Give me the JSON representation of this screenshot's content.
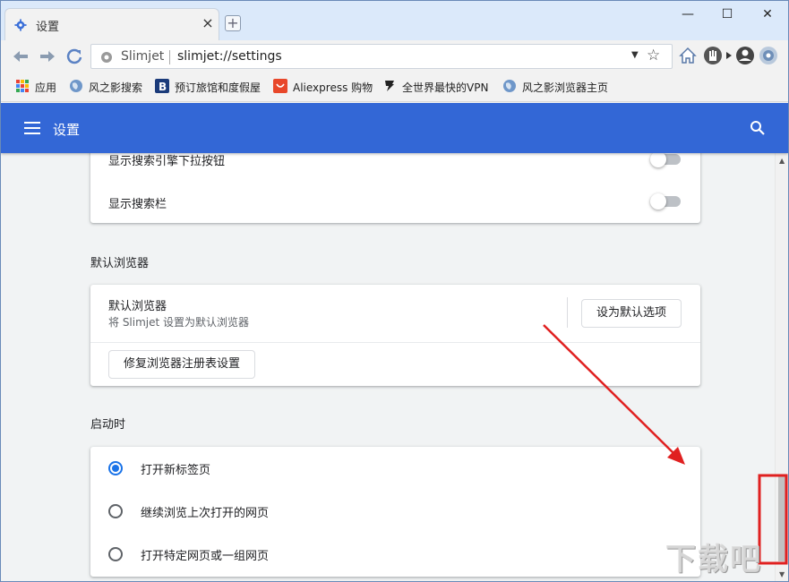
{
  "tab": {
    "title": "设置",
    "close": "×"
  },
  "newtab": "+",
  "window_controls": {
    "minimize": "—",
    "maximize": "☐",
    "close": "✕"
  },
  "omnibox": {
    "brand": "Slimjet",
    "url": "slimjet://settings",
    "dropdown": "▼",
    "star": "☆"
  },
  "bookmarks": [
    {
      "label": "应用",
      "icon": "apps-grid-icon"
    },
    {
      "label": "风之影搜索",
      "icon": "globe-icon"
    },
    {
      "label": "预订旅馆和度假屋",
      "icon": "booking-b-icon"
    },
    {
      "label": "Aliexpress 购物",
      "icon": "aliexpress-bag-icon"
    },
    {
      "label": "全世界最快的VPN",
      "icon": "vpn-icon"
    },
    {
      "label": "风之影浏览器主页",
      "icon": "globe-icon"
    }
  ],
  "header": {
    "title": "设置"
  },
  "search_section": {
    "rows": [
      {
        "label": "显示搜索引擎下拉按钮",
        "enabled": false
      },
      {
        "label": "显示搜索栏",
        "enabled": false
      }
    ]
  },
  "default_browser": {
    "section_title": "默认浏览器",
    "row_title": "默认浏览器",
    "row_sub": "将 Slimjet 设置为默认浏览器",
    "set_default_button": "设为默认选项",
    "repair_button": "修复浏览器注册表设置"
  },
  "startup": {
    "section_title": "启动时",
    "options": [
      {
        "label": "打开新标签页",
        "checked": true
      },
      {
        "label": "继续浏览上次打开的网页",
        "checked": false
      },
      {
        "label": "打开特定网页或一组网页",
        "checked": false
      }
    ]
  },
  "scrollbar": {
    "up": "▲",
    "down": "▼"
  },
  "watermark": "下载吧",
  "colors": {
    "accent": "#3367d6",
    "radio_checked": "#1a73e8",
    "annotation": "#e02020"
  }
}
